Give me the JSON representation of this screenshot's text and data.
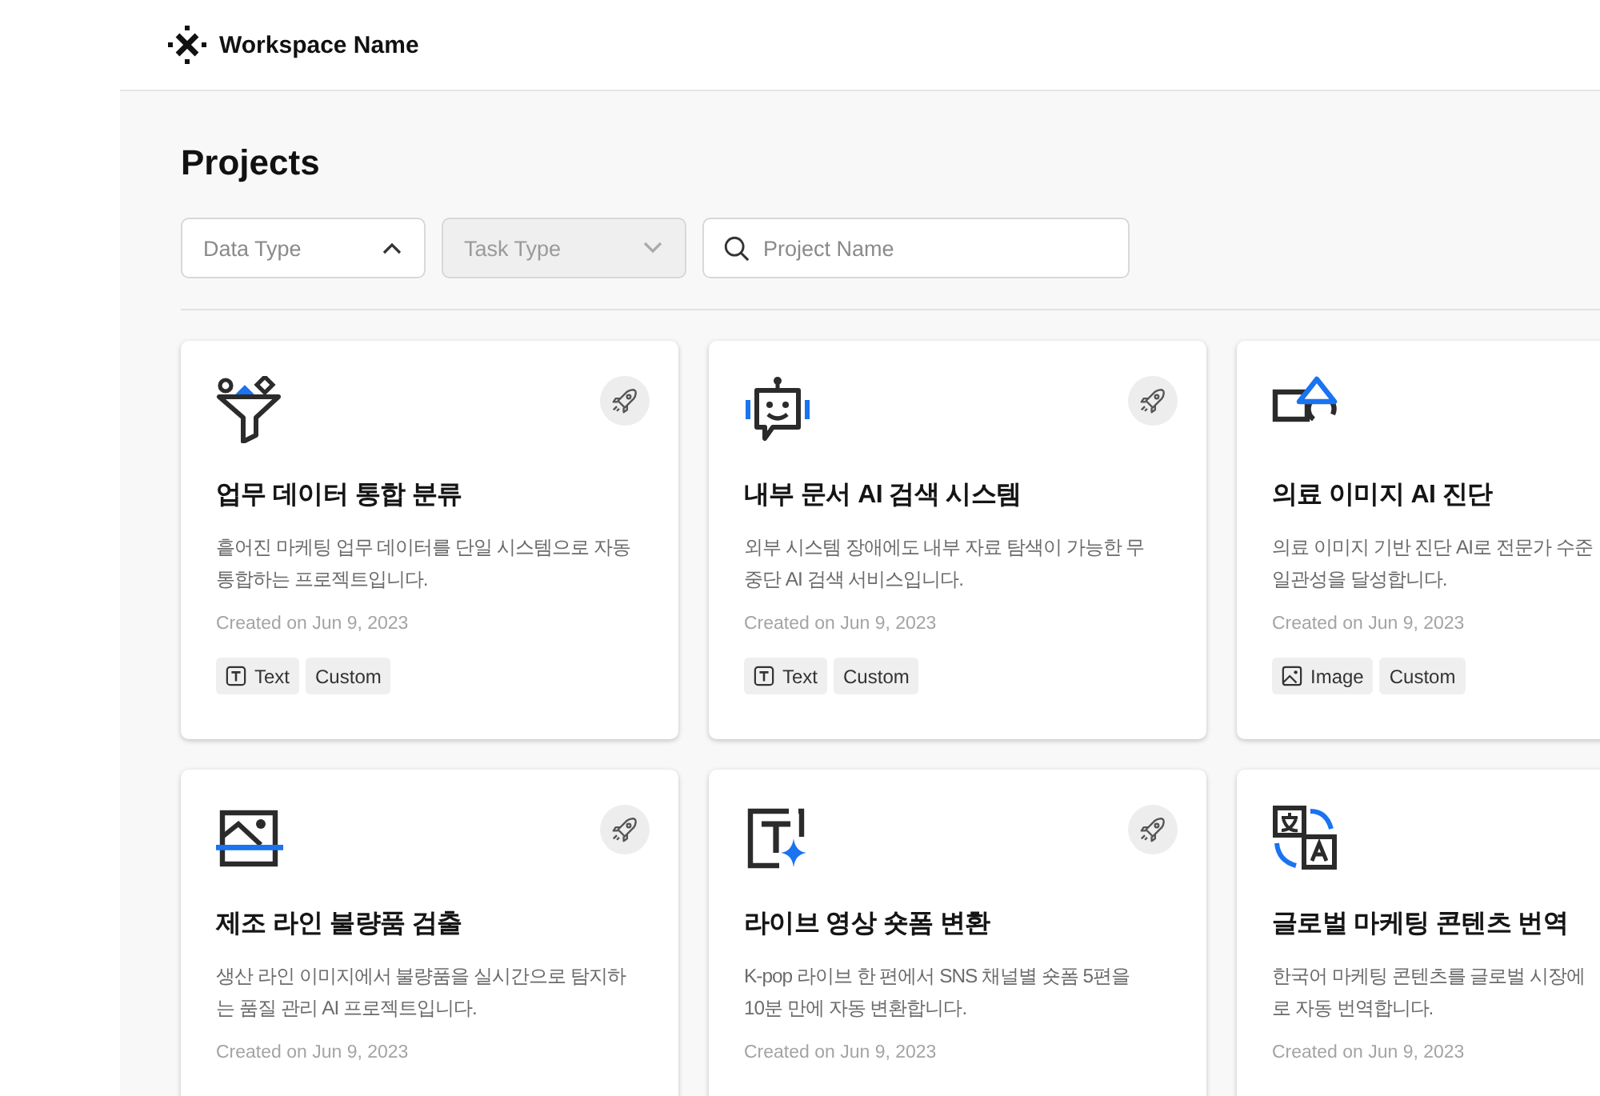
{
  "header": {
    "workspace": "Workspace Name"
  },
  "page": {
    "title": "Projects"
  },
  "filters": [
    {
      "kind": "dropdown",
      "placeholder": "Data Type",
      "expanded": true,
      "disabled": false
    },
    {
      "kind": "dropdown",
      "placeholder": "Task Type",
      "expanded": false,
      "disabled": true
    },
    {
      "kind": "search",
      "placeholder": "Project Name"
    }
  ],
  "projects": [
    {
      "kind": "filter",
      "title": "업무 데이터 통합 분류",
      "description": [
        "흩어진 마케팅 업무 데이터를 단일 시스템으로 자동",
        "통합하는 프로젝트입니다."
      ],
      "created": "Created on Jun 9, 2023",
      "tags": [
        {
          "kind": "text",
          "label": "Text"
        },
        {
          "kind": "plain",
          "label": "Custom"
        }
      ]
    },
    {
      "kind": "chatbot",
      "title": "내부 문서 AI 검색 시스템",
      "description": [
        "외부 시스템 장애에도 내부 자료 탐색이 가능한 무",
        "중단 AI 검색 서비스입니다."
      ],
      "created": "Created on Jun 9, 2023",
      "tags": [
        {
          "kind": "text",
          "label": "Text"
        },
        {
          "kind": "plain",
          "label": "Custom"
        }
      ]
    },
    {
      "kind": "shapes",
      "title": "의료 이미지 AI 진단",
      "description": [
        "의료 이미지 기반 진단 AI로 전문가 수준",
        "일관성을 달성합니다."
      ],
      "created": "Created on Jun 9, 2023",
      "tags": [
        {
          "kind": "image",
          "label": "Image"
        },
        {
          "kind": "plain",
          "label": "Custom"
        }
      ]
    },
    {
      "kind": "scan",
      "title": "제조 라인 불량품 검출",
      "description": [
        "생산 라인 이미지에서 불량품을 실시간으로 탐지하",
        "는 품질 관리 AI 프로젝트입니다."
      ],
      "created": "Created on Jun 9, 2023"
    },
    {
      "kind": "text-ai",
      "title": "라이브 영상 숏폼 변환",
      "description": [
        "K-pop 라이브 한 편에서 SNS 채널별 숏폼 5편을",
        "10분 만에 자동 변환합니다."
      ],
      "created": "Created on Jun 9, 2023"
    },
    {
      "kind": "translate",
      "title": "글로벌 마케팅 콘텐츠 번역",
      "description": [
        "한국어 마케팅 콘텐츠를 글로벌 시장에",
        "로 자동 번역합니다."
      ],
      "created": "Created on Jun 9, 2023"
    }
  ]
}
